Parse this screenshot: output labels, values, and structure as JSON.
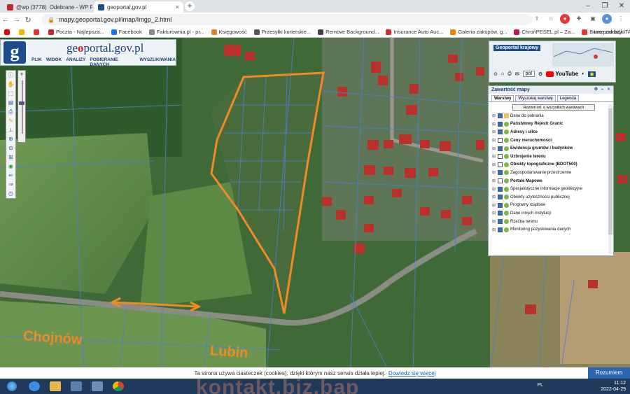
{
  "browser": {
    "tabs": [
      {
        "label": "Odebrane - WP Poc",
        "badge": "@wp (3778)"
      },
      {
        "label": "geoportal.gov.pl"
      }
    ],
    "new_tab": "+",
    "address": "mapy.geoportal.gov.pl/imap/Imgp_2.html",
    "bookmarks": [
      "",
      "",
      "",
      "Poczta - Najlepsza...",
      "Facebook",
      "Fakturownia.pl - pr...",
      "Księgowość",
      "Przesyłki kurierskie...",
      "Remove Background...",
      "Insurance Auto Auc...",
      "Galeria zakupów, g...",
      "ChroňPESEL.pl – Za...",
      "Biuro podróży ITAK..."
    ],
    "other_bookmarks": "Inne zakładki"
  },
  "geoportal": {
    "brand_prefix": "ge",
    "brand_o": "o",
    "brand_rest": "portal.gov.pl",
    "logo_letter": "g",
    "menu": [
      "PLIK",
      "WIDOK",
      "ANALIZY",
      "POBIERANIE DANYCH",
      "WYSZUKIWANIA"
    ],
    "krajowy_title": "Geoportal krajowy",
    "language": "pol",
    "youtube": "YouTube"
  },
  "layers_panel": {
    "title": "Zawartość mapy",
    "tabs": [
      "Warstwy",
      "Wyszukaj warstwę",
      "Legenda"
    ],
    "info_button": "Rozwiń inf. o wszystkich warstwach",
    "items": [
      {
        "label": "Dane do pobrania",
        "bold": false,
        "checked": true
      },
      {
        "label": "Państwowy Rejestr Granic",
        "bold": true,
        "checked": true
      },
      {
        "label": "Adresy i ulice",
        "bold": true,
        "checked": true
      },
      {
        "label": "Ceny nieruchomości",
        "bold": true,
        "checked": false
      },
      {
        "label": "Ewidencja gruntów i budynków",
        "bold": true,
        "checked": true
      },
      {
        "label": "Uzbrojenie terenu",
        "bold": true,
        "checked": false
      },
      {
        "label": "Obiekty topograficzne (BDOT500)",
        "bold": true,
        "checked": false
      },
      {
        "label": "Zagospodarowanie przestrzenne",
        "bold": false,
        "checked": true
      },
      {
        "label": "Portale Mapowe",
        "bold": true,
        "checked": false
      },
      {
        "label": "Specjalistyczne informacje geodezyjne",
        "bold": false,
        "checked": true
      },
      {
        "label": "Obiekty użyteczności publicznej",
        "bold": false,
        "checked": true
      },
      {
        "label": "Programy rządowe",
        "bold": false,
        "checked": true
      },
      {
        "label": "Dane innych instytucji",
        "bold": false,
        "checked": true
      },
      {
        "label": "Rzeźba terenu",
        "bold": false,
        "checked": true
      },
      {
        "label": "Monitoring pozyskiwania danych",
        "bold": false,
        "checked": true
      }
    ]
  },
  "map_labels": {
    "west": "Chojnów",
    "east": "Lubin"
  },
  "cookie": {
    "text": "Ta strona używa ciasteczek (cookies), dzięki którym nasz serwis działa lepiej.",
    "link": "Dowiedz się więcej",
    "button": "Rozumiem"
  },
  "taskbar": {
    "lang": "PL",
    "time": "11:12",
    "date": "2022-04-29"
  },
  "watermark": "kontakt.biz.bap"
}
